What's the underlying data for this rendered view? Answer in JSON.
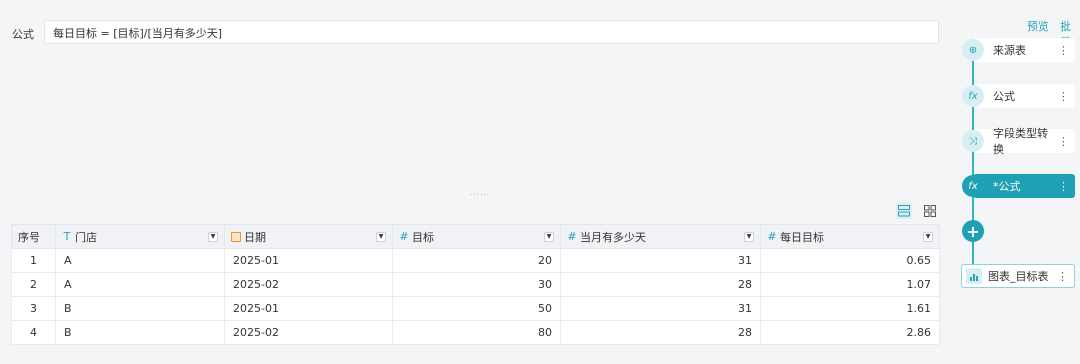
{
  "formula": {
    "label": "公式",
    "expression": "每日目标 = [目标]/[当月有多少天]"
  },
  "divider_handle": "……",
  "view_toggle": {
    "active_icon": "table-view-icon",
    "inactive_icon": "grid-view-icon"
  },
  "table": {
    "index_header": "序号",
    "columns": [
      {
        "label": "门店",
        "type_icon": "text-type-icon",
        "glyph": "T"
      },
      {
        "label": "日期",
        "type_icon": "date-type-icon",
        "glyph": ""
      },
      {
        "label": "目标",
        "type_icon": "number-type-icon",
        "glyph": "#"
      },
      {
        "label": "当月有多少天",
        "type_icon": "number-type-icon",
        "glyph": "#"
      },
      {
        "label": "每日目标",
        "type_icon": "number-type-icon",
        "glyph": "#"
      }
    ],
    "rows": [
      {
        "idx": "1",
        "store": "A",
        "date": "2025-01",
        "target": "20",
        "days": "31",
        "daily": "0.65"
      },
      {
        "idx": "2",
        "store": "A",
        "date": "2025-02",
        "target": "30",
        "days": "28",
        "daily": "1.07"
      },
      {
        "idx": "3",
        "store": "B",
        "date": "2025-01",
        "target": "50",
        "days": "31",
        "daily": "1.61"
      },
      {
        "idx": "4",
        "store": "B",
        "date": "2025-02",
        "target": "80",
        "days": "28",
        "daily": "2.86"
      }
    ]
  },
  "side": {
    "preview_link": "预览",
    "batch_link": "批量",
    "nodes": [
      {
        "label": "来源表",
        "icon": "source-table-icon",
        "glyph": "⊕",
        "active": false
      },
      {
        "label": "公式",
        "icon": "formula-icon",
        "glyph": "fx",
        "active": false
      },
      {
        "label": "字段类型转换",
        "icon": "shuffle-icon",
        "glyph": "⤨",
        "active": false
      },
      {
        "label": "*公式",
        "icon": "formula-icon",
        "glyph": "fx",
        "active": true
      }
    ],
    "add_glyph": "+",
    "chart_node": {
      "label": "图表_目标表",
      "icon": "bar-chart-icon"
    },
    "more_glyph": "⋮"
  },
  "colors": {
    "accent": "#1ea0b5",
    "accent_light": "#d7eef2",
    "date_icon": "#e8963c"
  }
}
